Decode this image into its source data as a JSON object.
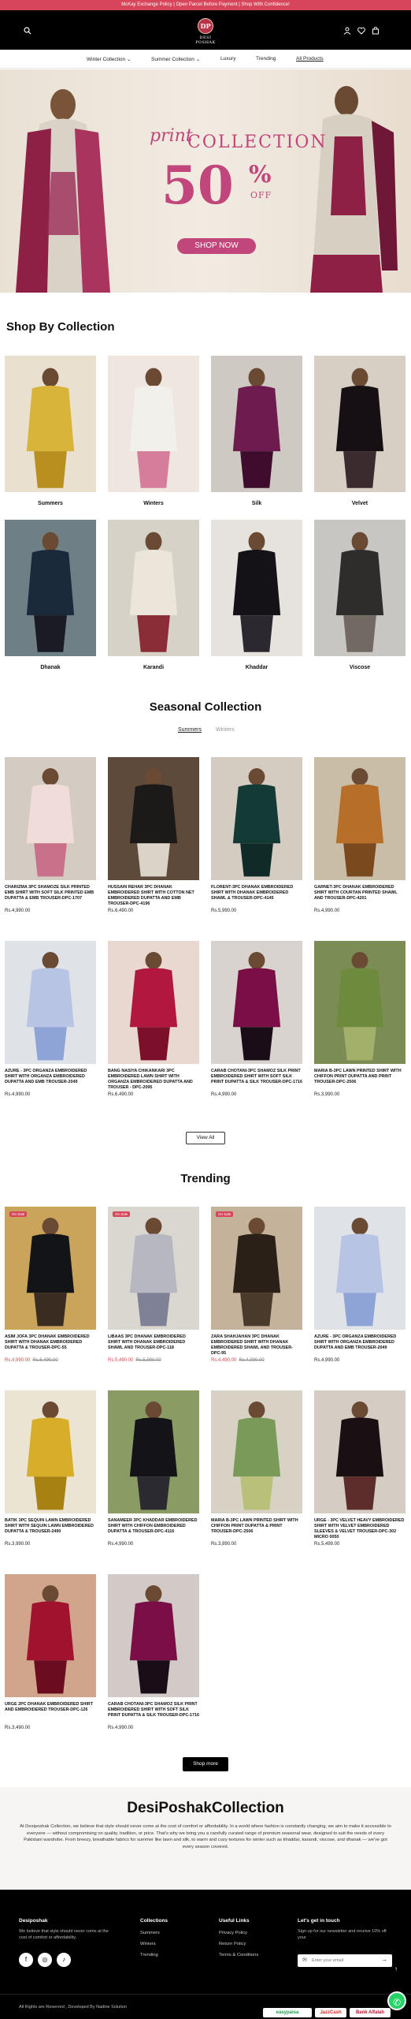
{
  "announcement": "McKay Exchange Policy | Open Parcel Before Payment | Shop With Confidence!",
  "brand": {
    "monogram": "DP",
    "name": "DESI POSHAK"
  },
  "nav": [
    {
      "label": "Winter Collection",
      "caret": "⌄"
    },
    {
      "label": "Summer Collection",
      "caret": "⌄"
    },
    {
      "label": "Luxury",
      "caret": ""
    },
    {
      "label": "Trending",
      "caret": ""
    },
    {
      "label": "All Products",
      "caret": ""
    }
  ],
  "hero": {
    "script": "print",
    "word": "COLLECTION",
    "percent_number": "50",
    "percent_sign": "%",
    "off": "OFF",
    "cta": "SHOP NOW"
  },
  "collections_title": "Shop By Collection",
  "collections": [
    {
      "label": "Summers"
    },
    {
      "label": "Winters"
    },
    {
      "label": "Silk"
    },
    {
      "label": "Velvet"
    },
    {
      "label": "Dhanak"
    },
    {
      "label": "Karandi"
    },
    {
      "label": "Khaddar"
    },
    {
      "label": "Viscose"
    }
  ],
  "seasonal": {
    "title": "Seasonal Collection",
    "tabs": [
      "Summers",
      "Winters"
    ],
    "products": [
      {
        "title": "CHARIZMA 3PC SHAMOZE SILK PRINTED EMB SHIRT WITH SOFT SILK PRINTED EMB DUPATTA & EMB TROUSER-DPC-1707",
        "price": "Rs.4,990.00"
      },
      {
        "title": "HUSSAIN REHAR 3PC DHANAK EMBROIDERED SHIRT WITH COTTON NET EMBROIDERED DUPATTA AND EMB TROUSER-DPC-4196",
        "price": "Rs.6,490.00"
      },
      {
        "title": "FLORENT-3PC DHANAK EMBROIDERED SHIRT WITH DHANAK EMBROIDERED SHAWL & TROUSER-DPC-4145",
        "price": "Rs.5,990.00"
      },
      {
        "title": "GARNET-3PC DHANAK EMBROIDERED SHIRT WITH COURTAN PRINTED SHAWL AND TROUSER-DPC-4201",
        "price": "Rs.4,990.00"
      },
      {
        "title": "AZURE - 3PC ORGANZA EMBROIDERED SHIRT WITH ORGANZA EMBROIDERED DUPATTA AND EMB TROUSER-2049",
        "price": "Rs.4,990.00"
      },
      {
        "title": "BANG NASIYA CHIKANKARI 3PC EMBROIDERED LAWN SHIRT WITH ORGANZA EMBROIDERED DUPATTA AND TROUSER - DPC-2095",
        "price": "Rs.6,490.00"
      },
      {
        "title": "CARAB CHOTANI-3PC SHAMOZ SILK PRINT EMBROIDERED SHIRT WITH SOFT SILK PRINT DUPATTA & SILK TROUSER-DPC-1716",
        "price": "Rs.4,990.00"
      },
      {
        "title": "MARIA B-3PC LAWN PRINTED SHIRT WITH CHIFFON PRINT DUPATTA AND PRINT TROUSER-DPC-2506",
        "price": "Rs.3,990.00"
      }
    ],
    "view_all": "View All"
  },
  "trending": {
    "title": "Trending",
    "products": [
      {
        "title": "ASIM JOFA 3PC DHANAK EMBROIDERED SHIRT WITH DHANAK EMBROIDERED DUPATTA & TROUSER-DPC-55",
        "price": "Rs.4,990.00",
        "old": "Rs.5,490.00",
        "badge": "On Sale"
      },
      {
        "title": "LIBAAS 3PC DHANAK EMBROIDERED SHIRT WITH DHANAK EMBROIDERED SHAWL AND TROUSER-DPC-118",
        "price": "Rs.5,490.00",
        "old": "Rs.5,990.00",
        "badge": "On Sale"
      },
      {
        "title": "ZARA SHAHJAHAN 3PC DHANAK EMBROIDERED SHIRT WITH DHANAK EMBROIDERED SHAWL AND TROUSER-DPC-95",
        "price": "Rs.4,490.00",
        "old": "Rs.4,990.00",
        "badge": "On Sale"
      },
      {
        "title": "AZURE - 3PC ORGANZA EMBROIDERED SHIRT WITH ORGANZA EMBROIDERED DUPATTA AND EMB TROUSER-2049",
        "price": "Rs.4,990.00",
        "old": "",
        "badge": ""
      },
      {
        "title": "BATIK 3PC SEQUIN LAWN EMBROIDERED SHIRT WITH SEQUIN LAWN EMBROIDERED DUPATTA & TROUSER-2490",
        "price": "Rs.3,990.00",
        "old": "",
        "badge": ""
      },
      {
        "title": "SANAMEER 3PC KHADDAR EMBROIDERED SHIRT WITH CHIFFON EMBROIDERED DUPATTA & TROUSER-DPC-4116",
        "price": "Rs.4,990.00",
        "old": "",
        "badge": ""
      },
      {
        "title": "MARIA B-3PC LAWN PRINTED SHIRT WITH CHIFFON PRINT DUPATTA & PRINT TROUSER-DPC-2506",
        "price": "Rs.3,990.00",
        "old": "",
        "badge": ""
      },
      {
        "title": "URGE - 3PC VELVET HEAVY EMBROIDERED SHIRT WITH VELVET EMBROIDERED SLEEVES & VELVET TROUSER-DPC-302 MICRO 0050",
        "price": "Rs.5,499.00",
        "old": "",
        "badge": ""
      },
      {
        "title": "URGE 2PC DHANAK EMBROIDERED SHIRT AND EMBROIDERED TROUSER-DPC-126",
        "price": "Rs.3,490.00",
        "old": "",
        "badge": ""
      },
      {
        "title": "CARAB CHOTANI-3PC SHAMOZ SILK PRINT EMBROIDERED SHIRT WITH SOFT SILK PRINT DUPATTA & SILK TROUSER-DPC-1716",
        "price": "Rs.4,990.00",
        "old": "",
        "badge": ""
      }
    ],
    "shop_more": "Shop more"
  },
  "about": {
    "title": "DesiPoshakCollection",
    "text": "At Desiposhak Collection, we believe that style should never come at the cost of comfort or affordability. In a world where fashion is constantly changing, we aim to make it accessible to everyone — without compromising on quality, tradition, or price. That's why we bring you a carefully curated range of premium seasonal wear, designed to suit the needs of every Pakistani wardrobe. From breezy, breathable fabrics for summer like lawn and silk, to warm and cozy textures for winter such as khaddar, karandi, viscose, and dhanak — we've got every season covered."
  },
  "footer": {
    "brand_head": "Desiposhak",
    "brand_text": "We believe that style should never come at the cost of comfort or affordability.",
    "collections_head": "Collections",
    "collections_links": [
      "Summers",
      "Winters",
      "Trending"
    ],
    "useful_head": "Useful Links",
    "useful_links": [
      "Privacy Policy",
      "Return Policy",
      "Terms & Conditions"
    ],
    "touch_head": "Let's get in touch",
    "touch_text": "Sign up for our newsletter and receive 10% off your",
    "email_placeholder": "Enter your email",
    "copyright": "All Rights are Reserved , Developed By Nadine Solution",
    "payments": [
      "easypaisa",
      "JazzCash",
      "Bank Alfalah"
    ]
  },
  "colors": {
    "accent": "#d6455a",
    "hero_pink": "#c0467b",
    "dark": "#000000"
  }
}
